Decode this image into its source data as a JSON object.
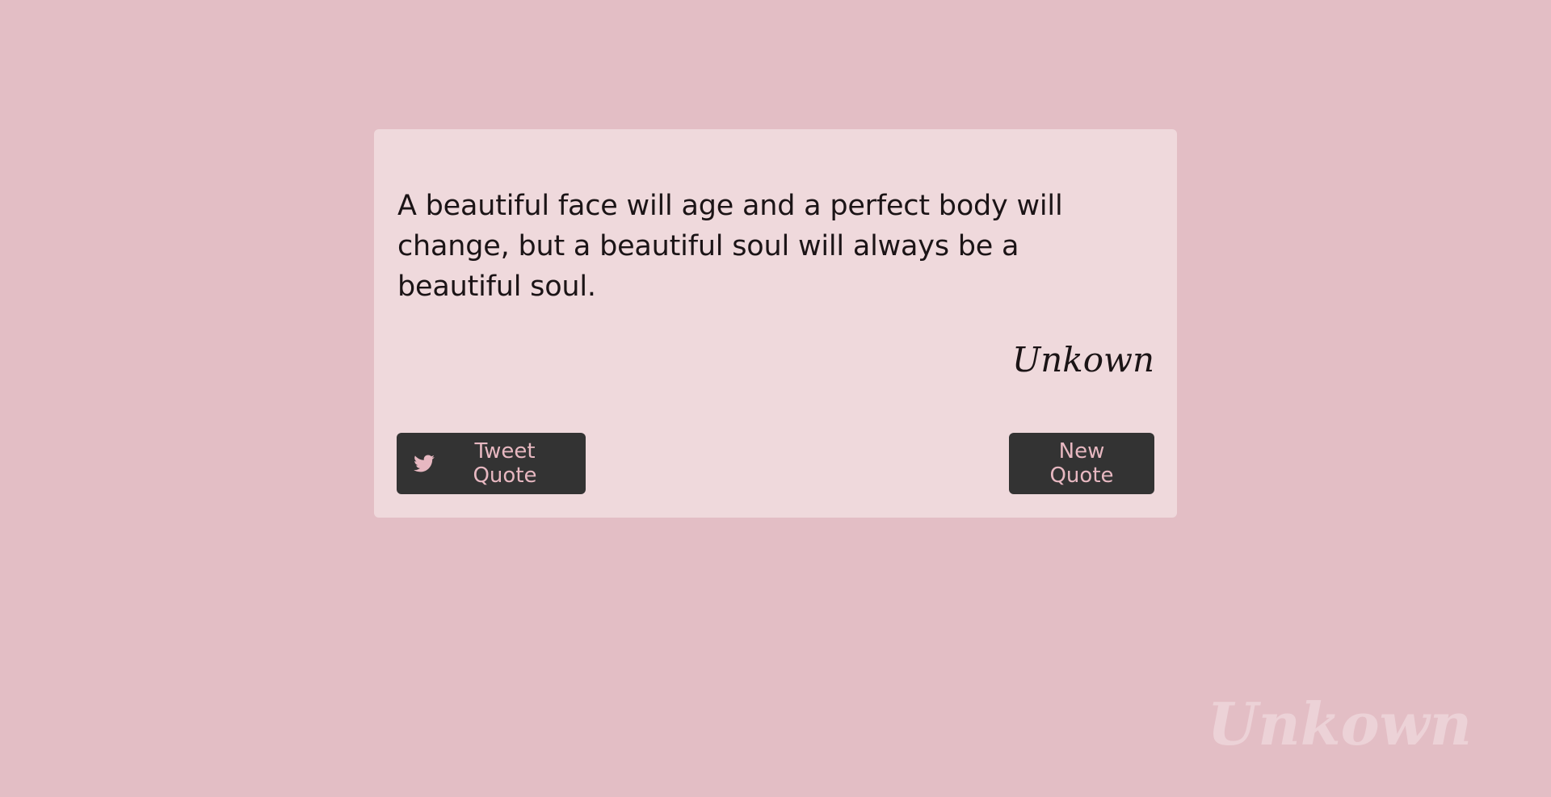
{
  "page": {
    "background_color": "#e3bec5"
  },
  "quote_card": {
    "background_color": "#efd9dc",
    "quote_text": "A beautiful face will age and a perfect body will change, but a beautiful soul will always be a beautiful soul.",
    "author": "Unkown"
  },
  "buttons": {
    "tweet_label": "Tweet Quote",
    "tweet_icon": "twitter-icon",
    "new_quote_label": "New Quote",
    "background_color": "#333333",
    "text_color": "#e7b8c1"
  },
  "watermark": {
    "author": "Unkown"
  }
}
